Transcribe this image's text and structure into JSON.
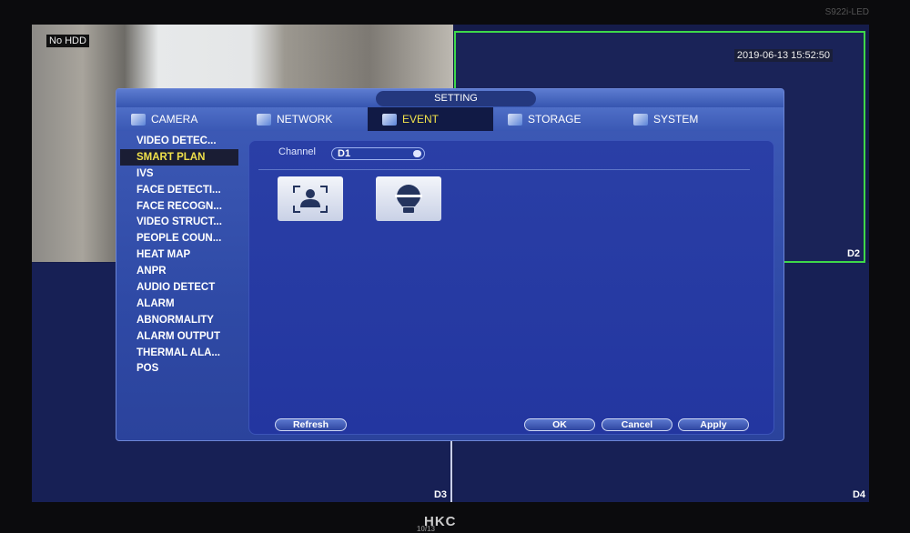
{
  "monitor": {
    "model_label": "S922i-LED",
    "brand": "HKC",
    "page_indicator": "10/13"
  },
  "views": {
    "no_hdd": "No HDD",
    "timestamp": "2019-06-13 15:52:50",
    "labels": [
      "D2",
      "D3",
      "D4"
    ]
  },
  "dialog": {
    "title": "SETTING",
    "tabs": [
      {
        "label": "CAMERA"
      },
      {
        "label": "NETWORK"
      },
      {
        "label": "EVENT",
        "active": true
      },
      {
        "label": "STORAGE"
      },
      {
        "label": "SYSTEM"
      }
    ],
    "sidebar": [
      "VIDEO DETEC...",
      "SMART PLAN",
      "IVS",
      "FACE DETECTI...",
      "FACE RECOGN...",
      "VIDEO STRUCT...",
      "PEOPLE COUN...",
      "HEAT MAP",
      "ANPR",
      "AUDIO DETECT",
      "ALARM",
      "ABNORMALITY",
      "ALARM OUTPUT",
      "THERMAL ALA...",
      "POS"
    ],
    "sidebar_active": "SMART PLAN",
    "channel_label": "Channel",
    "channel_value": "D1",
    "plans": [
      "face-detection-icon",
      "ivs-bulb-icon"
    ],
    "buttons": {
      "refresh": "Refresh",
      "ok": "OK",
      "cancel": "Cancel",
      "apply": "Apply"
    }
  },
  "colors": {
    "active_text": "#f2e34a",
    "selected_view_border": "#3ed84a",
    "panel": "#2b439c"
  }
}
